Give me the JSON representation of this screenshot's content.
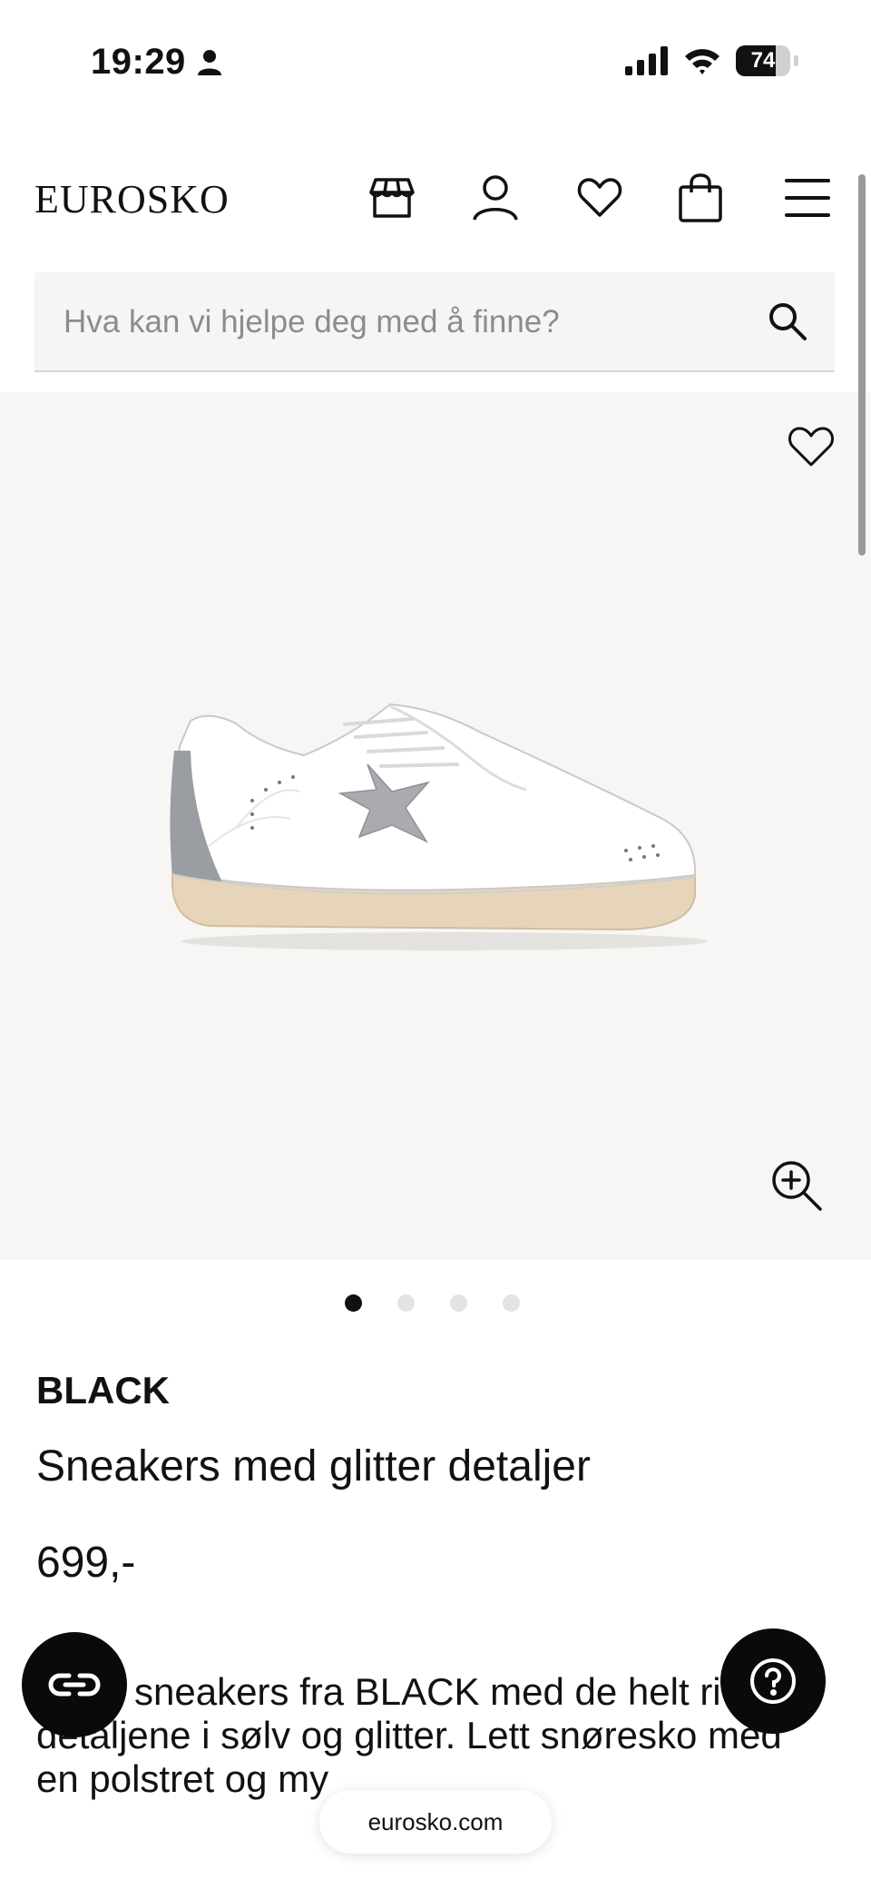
{
  "status_bar": {
    "time": "19:29",
    "battery": "74",
    "battery_level": 0.74
  },
  "header": {
    "logo": "EUROSKO",
    "icons": [
      "store-icon",
      "account-icon",
      "heart-icon",
      "bag-icon",
      "menu-icon"
    ]
  },
  "search": {
    "placeholder": "Hva kan vi hjelpe deg med å finne?"
  },
  "gallery": {
    "slide_count": 4,
    "active_slide": 1
  },
  "product": {
    "brand": "BLACK",
    "name": "Sneakers med glitter detaljer",
    "price": "699,-",
    "description": "sneakers fra BLACK med de helt ri detaljene i sølv og glitter. Lett snøresko med en polstret og my"
  },
  "browser": {
    "url": "eurosko.com"
  },
  "colors": {
    "background": "#ffffff",
    "gallery_bg": "#f7f6f4",
    "search_bg": "#f5f5f5",
    "text": "#111111",
    "floating_button": "#0a0a0a"
  }
}
